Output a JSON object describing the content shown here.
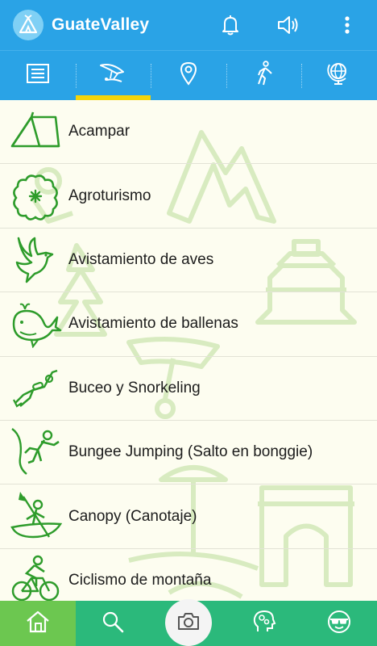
{
  "app": {
    "title": "GuateValley"
  },
  "colors": {
    "primary": "#2aa3e6",
    "tab_indicator": "#f4d40a",
    "bottom_bar": "#2bb97b",
    "bottom_active": "#6cc750",
    "icon_green": "#2e9c2b",
    "background": "#fdfdf0"
  },
  "appbar": {
    "icons": [
      "tent-logo-icon",
      "bell-icon",
      "speaker-icon",
      "more-vert-icon"
    ]
  },
  "tabs": [
    {
      "name": "list-icon",
      "active": false
    },
    {
      "name": "hang-glider-icon",
      "active": true
    },
    {
      "name": "location-pin-icon",
      "active": false
    },
    {
      "name": "walking-person-icon",
      "active": false
    },
    {
      "name": "globe-icon",
      "active": false
    }
  ],
  "activities": [
    {
      "label": "Acampar",
      "icon": "tent-icon"
    },
    {
      "label": "Agroturismo",
      "icon": "flower-icon"
    },
    {
      "label": "Avistamiento de aves",
      "icon": "bird-icon"
    },
    {
      "label": "Avistamiento de ballenas",
      "icon": "whale-icon"
    },
    {
      "label": "Buceo y Snorkeling",
      "icon": "diver-icon"
    },
    {
      "label": "Bungee Jumping (Salto en bonggie)",
      "icon": "bungee-jumper-icon"
    },
    {
      "label": "Canopy (Canotaje)",
      "icon": "canoe-icon"
    },
    {
      "label": "Ciclismo de montaña",
      "icon": "cyclist-icon"
    }
  ],
  "bottom_nav": [
    {
      "name": "home-icon",
      "active": true
    },
    {
      "name": "search-icon",
      "active": false
    },
    {
      "name": "camera-icon",
      "active": false
    },
    {
      "name": "head-gears-icon",
      "active": false
    },
    {
      "name": "sunglasses-face-icon",
      "active": false
    }
  ]
}
